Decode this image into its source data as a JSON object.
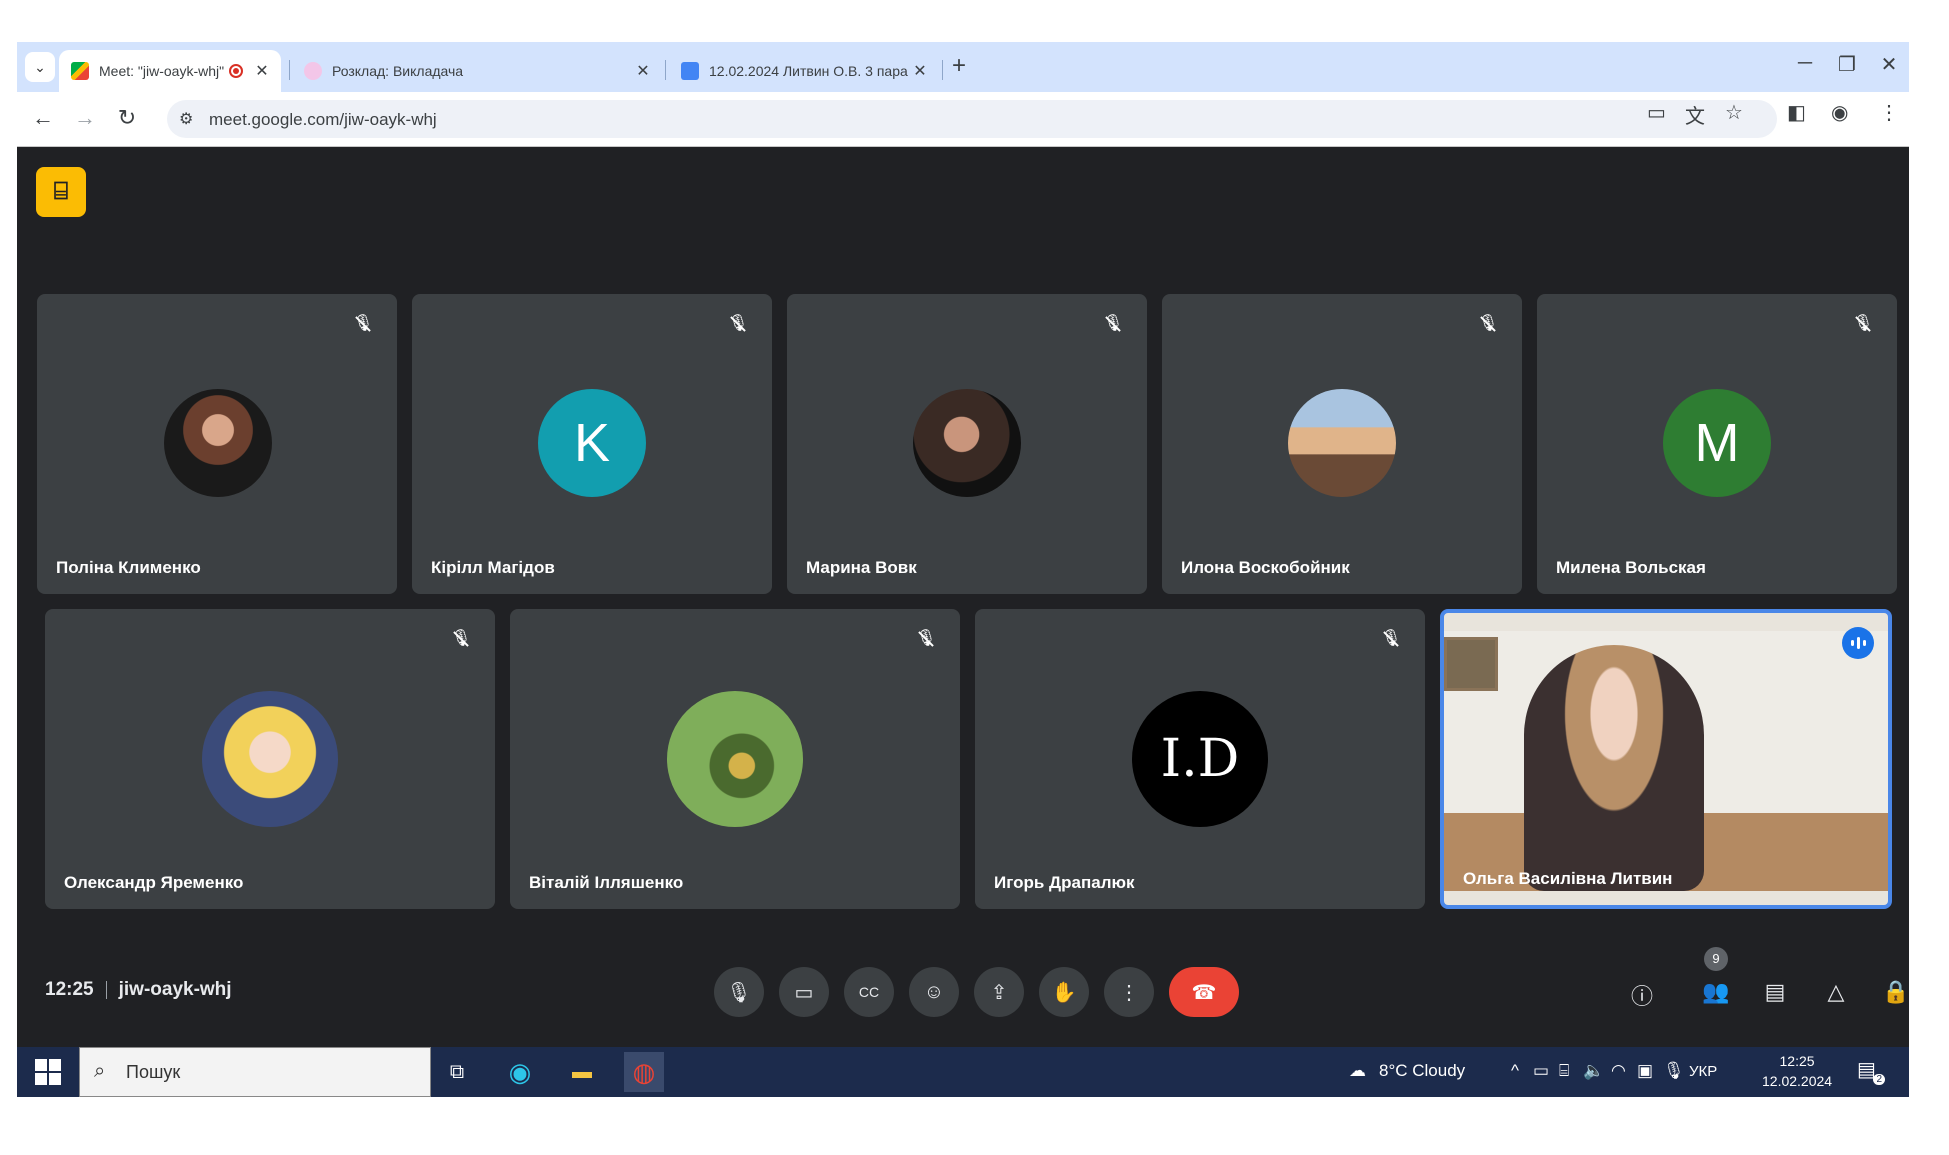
{
  "browser": {
    "tabs": [
      {
        "title": "Meet: \"jiw-oayk-whj\"",
        "active": true,
        "recording": true
      },
      {
        "title": "Розклад: Викладача",
        "active": false
      },
      {
        "title": "12.02.2024 Литвин О.В. 3 пара",
        "active": false
      }
    ],
    "new_tab_label": "+",
    "url": "meet.google.com/jiw-oayk-whj"
  },
  "meet": {
    "participants_row1": [
      {
        "name": "Поліна Клименко",
        "avatar_type": "photo",
        "avatar_color": "#7a5a50"
      },
      {
        "name": "Кірілл Магідов",
        "avatar_type": "letter",
        "letter": "K",
        "avatar_color": "#129eaf"
      },
      {
        "name": "Марина Вовк",
        "avatar_type": "photo",
        "avatar_color": "#2a2220"
      },
      {
        "name": "Илона Воскобойник",
        "avatar_type": "photo",
        "avatar_color": "#c98a5c"
      },
      {
        "name": "Милена Вольская",
        "avatar_type": "letter",
        "letter": "M",
        "avatar_color": "#2e7d32"
      }
    ],
    "participants_row2": [
      {
        "name": "Олександр Яременко",
        "avatar_type": "photo",
        "avatar_color": "#e8d27a"
      },
      {
        "name": "Віталій Ілляшенко",
        "avatar_type": "photo",
        "avatar_color": "#6c9a4a"
      },
      {
        "name": "Игорь Драпалюк",
        "avatar_type": "logo",
        "logo_text": "I.D",
        "avatar_color": "#000000"
      },
      {
        "name": "Ольга Василівна Литвин",
        "avatar_type": "video",
        "speaking": true
      }
    ],
    "time": "12:25",
    "meeting_code": "jiw-oayk-whj",
    "people_count": "9"
  },
  "taskbar": {
    "search_placeholder": "Пошук",
    "weather": "8°C  Cloudy",
    "language": "УКР",
    "time": "12:25",
    "date": "12.02.2024",
    "notifications": "2"
  },
  "colors": {
    "meet_bg": "#202124",
    "tile_bg": "#3c4043",
    "end_call": "#ea4335",
    "speaking": "#1a73e8",
    "tab_strip": "#d3e3fd",
    "taskbar": "#1c2b4c"
  }
}
